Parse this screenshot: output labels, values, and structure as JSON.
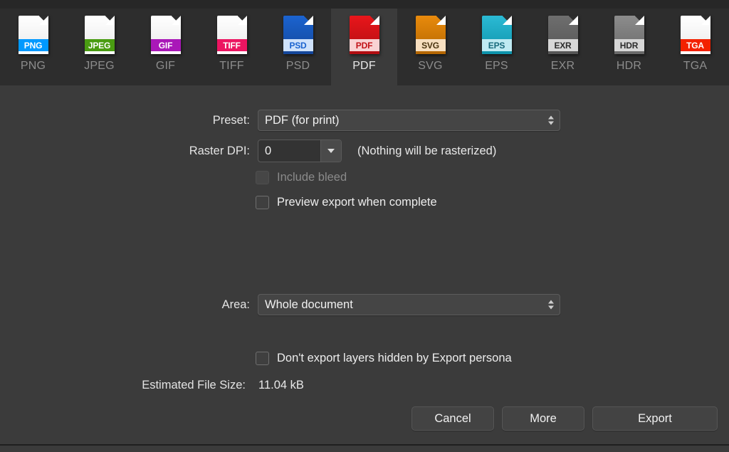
{
  "tabs": [
    {
      "label": "PNG",
      "icon": "file-icon-png",
      "selected": false,
      "page_color": "#ffffff",
      "page_color2": "#e9e9e9",
      "band_color": "#0099ff",
      "band_text_color": "#ffffff",
      "foot_color": "#ffffff"
    },
    {
      "label": "JPEG",
      "icon": "file-icon-jpeg",
      "selected": false,
      "page_color": "#ffffff",
      "page_color2": "#e9e9e9",
      "band_color": "#4a9c12",
      "band_text_color": "#ffffff",
      "foot_color": "#ffffff"
    },
    {
      "label": "GIF",
      "icon": "file-icon-gif",
      "selected": false,
      "page_color": "#ffffff",
      "page_color2": "#e9e9e9",
      "band_color": "#a918b8",
      "band_text_color": "#ffffff",
      "foot_color": "#ffffff"
    },
    {
      "label": "TIFF",
      "icon": "file-icon-tiff",
      "selected": false,
      "page_color": "#ffffff",
      "page_color2": "#e9e9e9",
      "band_color": "#ec1561",
      "band_text_color": "#ffffff",
      "foot_color": "#ffffff"
    },
    {
      "label": "PSD",
      "icon": "file-icon-psd",
      "selected": false,
      "page_color": "#1b63cf",
      "page_color2": "#14479b",
      "band_color": "#cfe2fb",
      "band_text_color": "#1b63cf",
      "foot_color": "#14479b"
    },
    {
      "label": "PDF",
      "icon": "file-icon-pdf",
      "selected": true,
      "page_color": "#e8161b",
      "page_color2": "#b20d11",
      "band_color": "#f9d2d3",
      "band_text_color": "#c21217",
      "foot_color": "#b20d11"
    },
    {
      "label": "SVG",
      "icon": "file-icon-svg",
      "selected": false,
      "page_color": "#e88a0c",
      "page_color2": "#b56700",
      "band_color": "#f7dfc0",
      "band_text_color": "#4a3410",
      "foot_color": "#b56700"
    },
    {
      "label": "EPS",
      "icon": "file-icon-eps",
      "selected": false,
      "page_color": "#2bbad4",
      "page_color2": "#0d93ab",
      "band_color": "#bfeaf2",
      "band_text_color": "#186a7c",
      "foot_color": "#0d93ab"
    },
    {
      "label": "EXR",
      "icon": "file-icon-exr",
      "selected": false,
      "page_color": "#6e6e6e",
      "page_color2": "#565656",
      "band_color": "#d7d7d7",
      "band_text_color": "#2c2c2c",
      "foot_color": "#565656"
    },
    {
      "label": "HDR",
      "icon": "file-icon-hdr",
      "selected": false,
      "page_color": "#8c8c8c",
      "page_color2": "#6a6a6a",
      "band_color": "#d7d7d7",
      "band_text_color": "#2c2c2c",
      "foot_color": "#6a6a6a"
    },
    {
      "label": "TGA",
      "icon": "file-icon-tga",
      "selected": false,
      "page_color": "#ffffff",
      "page_color2": "#e9e9e9",
      "band_color": "#f32100",
      "band_text_color": "#ffffff",
      "foot_color": "#ffffff"
    }
  ],
  "form": {
    "preset_label": "Preset:",
    "preset_value": "PDF (for print)",
    "raster_dpi_label": "Raster DPI:",
    "raster_dpi_value": "0",
    "raster_dpi_note": "(Nothing will be rasterized)",
    "include_bleed_label": "Include bleed",
    "include_bleed_checked": false,
    "include_bleed_disabled": true,
    "preview_export_label": "Preview export when complete",
    "preview_export_checked": false,
    "area_label": "Area:",
    "area_value": "Whole document",
    "dont_export_hidden_label": "Don't export layers hidden by Export persona",
    "dont_export_hidden_checked": false,
    "file_size_label": "Estimated File Size:",
    "file_size_value": "11.04 kB"
  },
  "buttons": {
    "cancel": "Cancel",
    "more": "More",
    "export": "Export"
  },
  "colors": {
    "window_bg": "#3b3b3b",
    "tabbar_bg": "#2d2d2d",
    "top_strip": "#272727",
    "text": "#ededed",
    "text_dim": "#8d8d8d"
  }
}
